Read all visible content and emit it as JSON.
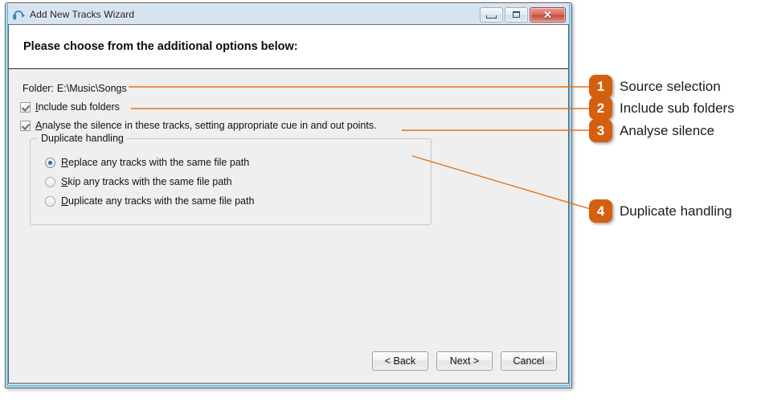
{
  "window": {
    "title": "Add New Tracks Wizard",
    "icon": "headphones-icon",
    "controls": {
      "minimize": "–",
      "maximize": "□",
      "close": "✕"
    }
  },
  "header": {
    "title": "Please choose from the additional options below:"
  },
  "form": {
    "folder_label": "Folder:",
    "folder_value": "E:\\Music\\Songs",
    "include_sub_folders": {
      "accel": "I",
      "rest": "nclude sub folders",
      "checked": true
    },
    "analyse_silence": {
      "accel": "A",
      "rest": "nalyse the silence in these tracks, setting appropriate cue in and out points.",
      "checked": true
    },
    "duplicate_group": {
      "legend": "Duplicate handling",
      "options": [
        {
          "accel": "R",
          "rest": "eplace any tracks with the same file path",
          "selected": true
        },
        {
          "accel": "S",
          "rest": "kip any tracks with the same file path",
          "selected": false
        },
        {
          "accel": "D",
          "rest": "uplicate any tracks with the same file path",
          "selected": false
        }
      ]
    }
  },
  "footer": {
    "back": "< Back",
    "next": "Next >",
    "cancel": "Cancel"
  },
  "callouts": [
    {
      "number": "1",
      "label": "Source selection"
    },
    {
      "number": "2",
      "label": "Include sub folders"
    },
    {
      "number": "3",
      "label": "Analyse silence"
    },
    {
      "number": "4",
      "label": "Duplicate handling"
    }
  ],
  "colors": {
    "accent_orange": "#d4600f",
    "connector_orange": "#e2711d",
    "window_border_blue": "#6cc5e8",
    "radio_dot_blue": "#2d6f9e"
  }
}
